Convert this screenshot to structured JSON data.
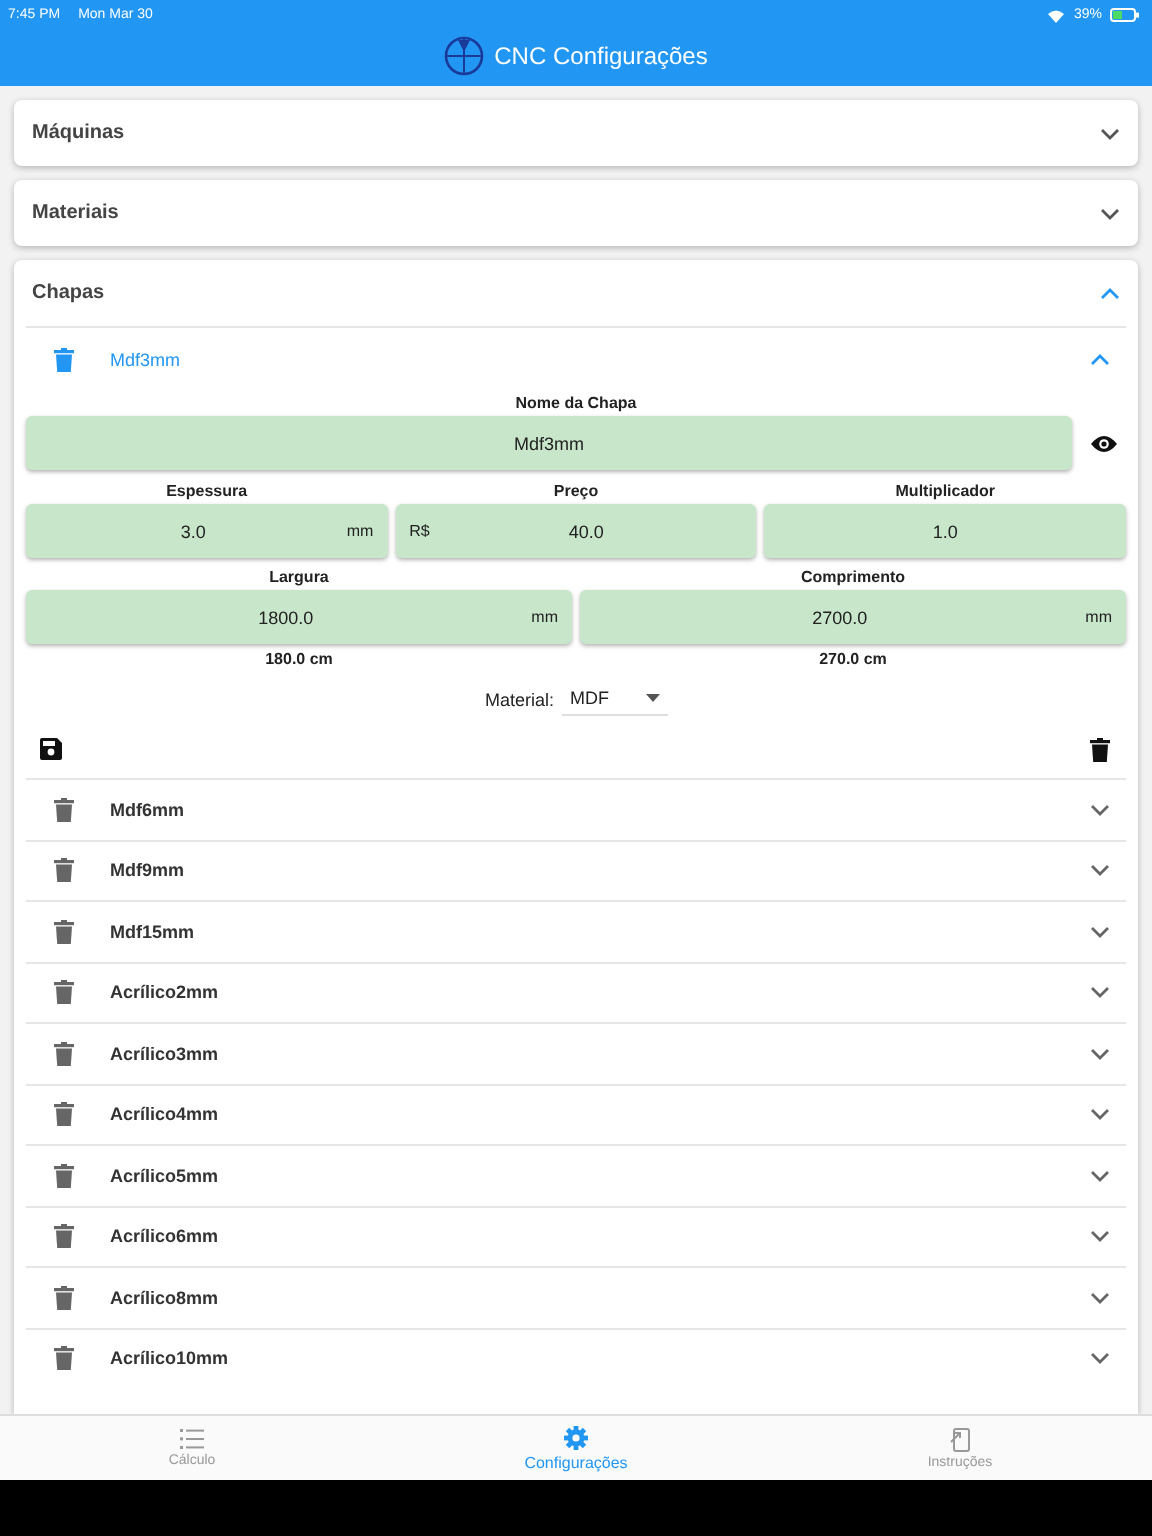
{
  "status_bar": {
    "time": "7:45 PM",
    "date": "Mon Mar 30",
    "battery": "39%"
  },
  "app_bar": {
    "title": "CNC Configurações"
  },
  "sections": [
    {
      "title": "Máquinas",
      "expanded": false
    },
    {
      "title": "Materiais",
      "expanded": false
    },
    {
      "title": "Chapas",
      "expanded": true,
      "sheets": [
        {
          "name": "Mdf3mm",
          "expanded": true,
          "form": {
            "name_label": "Nome da Chapa",
            "name_value": "Mdf3mm",
            "thickness_label": "Espessura",
            "thickness_value": "3.0",
            "thickness_unit": "mm",
            "price_label": "Preço",
            "price_prefix": "R$",
            "price_value": "40.0",
            "multiplier_label": "Multiplicador",
            "multiplier_value": "1.0",
            "width_label": "Largura",
            "width_value": "1800.0",
            "width_unit": "mm",
            "width_cm": "180.0 cm",
            "length_label": "Comprimento",
            "length_value": "2700.0",
            "length_unit": "mm",
            "length_cm": "270.0 cm",
            "material_label": "Material:",
            "material_value": "MDF"
          }
        },
        {
          "name": "Mdf6mm",
          "expanded": false
        },
        {
          "name": "Mdf9mm",
          "expanded": false
        },
        {
          "name": "Mdf15mm",
          "expanded": false
        },
        {
          "name": "Acrílico2mm",
          "expanded": false
        },
        {
          "name": "Acrílico3mm",
          "expanded": false
        },
        {
          "name": "Acrílico4mm",
          "expanded": false
        },
        {
          "name": "Acrílico5mm",
          "expanded": false
        },
        {
          "name": "Acrílico6mm",
          "expanded": false
        },
        {
          "name": "Acrílico8mm",
          "expanded": false
        },
        {
          "name": "Acrílico10mm",
          "expanded": false
        }
      ]
    }
  ],
  "bottom_nav": [
    {
      "label": "Cálculo",
      "selected": false
    },
    {
      "label": "Configurações",
      "selected": true
    },
    {
      "label": "Instruções",
      "selected": false
    }
  ]
}
